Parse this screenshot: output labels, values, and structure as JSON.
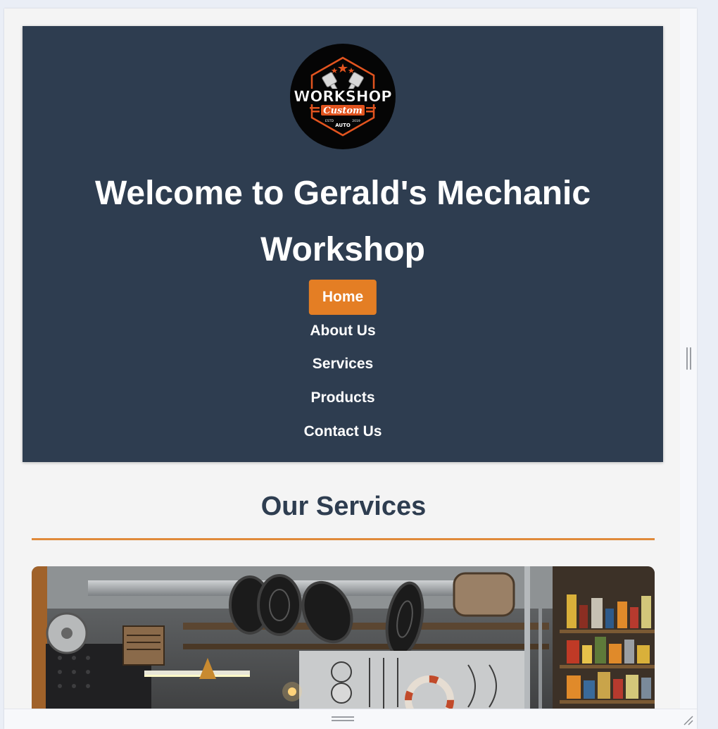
{
  "header": {
    "logo": {
      "title": "WORKSHOP",
      "subtitle": "Custom",
      "tagline": "AUTO",
      "est_left": "ESTD",
      "est_right": "2019",
      "icon": "pistons-logo-icon"
    },
    "welcome_title": "Welcome to Gerald's Mechanic Workshop"
  },
  "nav": {
    "items": [
      {
        "label": "Home",
        "active": true
      },
      {
        "label": "About Us",
        "active": false
      },
      {
        "label": "Services",
        "active": false
      },
      {
        "label": "Products",
        "active": false
      },
      {
        "label": "Contact Us",
        "active": false
      }
    ]
  },
  "services": {
    "title": "Our Services",
    "image_icon": "workshop-garage-image"
  },
  "colors": {
    "header_bg": "#2e3d50",
    "accent": "#e47e24",
    "title_text": "#2e3d50",
    "page_bg": "#f4f4f4"
  }
}
